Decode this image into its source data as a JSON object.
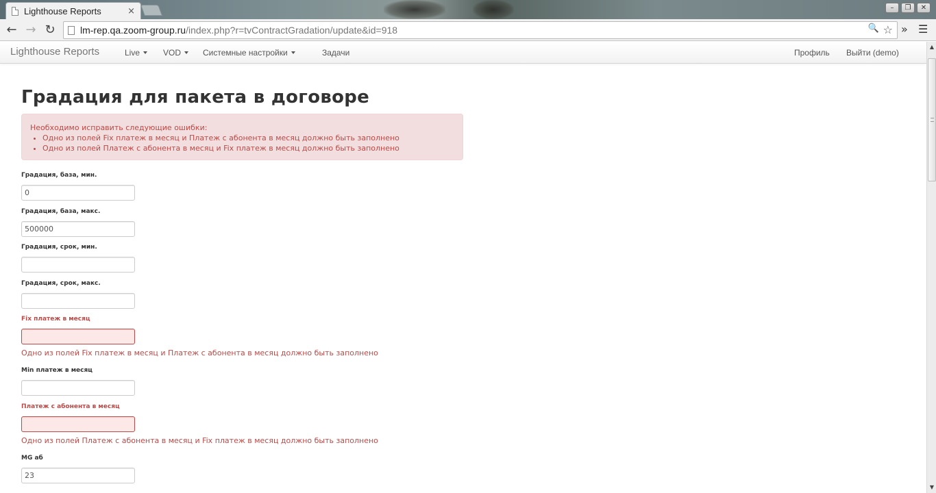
{
  "browser": {
    "tab_title": "Lighthouse Reports",
    "tab_close": "×",
    "window_buttons": [
      "–",
      "❐",
      "✕"
    ],
    "url_host": "lm-rep.qa.zoom-group.ru",
    "url_path": "/index.php?r=tvContractGradation/update&id=918",
    "back_icon": "←",
    "forward_icon": "→",
    "reload_icon": "↻",
    "zoom_icon": "🔍",
    "star_icon": "☆",
    "more_icon": "»",
    "menu_icon": "☰"
  },
  "navbar": {
    "brand": "Lighthouse Reports",
    "items": [
      {
        "label": "Live",
        "dropdown": true
      },
      {
        "label": "VOD",
        "dropdown": true
      },
      {
        "label": "Системные настройки",
        "dropdown": true
      },
      {
        "label": "Задачи",
        "dropdown": false
      }
    ],
    "right_items": [
      {
        "label": "Профиль"
      },
      {
        "label": "Выйти (demo)"
      }
    ]
  },
  "page": {
    "title": "Градация для пакета в договоре",
    "error_summary": {
      "heading": "Необходимо исправить следующие ошибки:",
      "items": [
        "Одно из полей Fix платеж в месяц и Платеж с абонента в месяц должно быть заполнено",
        "Одно из полей Платеж с абонента в месяц и Fix платеж в месяц должно быть заполнено"
      ]
    },
    "fields": [
      {
        "label": "Градация, база, мин.",
        "value": "0",
        "error": ""
      },
      {
        "label": "Градация, база, макс.",
        "value": "500000",
        "error": ""
      },
      {
        "label": "Градация, срок, мин.",
        "value": "",
        "error": ""
      },
      {
        "label": "Градация, срок, макс.",
        "value": "",
        "error": ""
      },
      {
        "label": "Fix платеж в месяц",
        "value": "",
        "error": "Одно из полей Fix платеж в месяц и Платеж с абонента в месяц должно быть заполнено"
      },
      {
        "label": "Min платеж в месяц",
        "value": "",
        "error": ""
      },
      {
        "label": "Платеж с абонента в месяц",
        "value": "",
        "error": "Одно из полей Платеж с абонента в месяц и Fix платеж в месяц должно быть заполнено"
      },
      {
        "label": "MG аб",
        "value": "23",
        "error": ""
      }
    ]
  },
  "colors": {
    "error_text": "#b94a48",
    "error_bg": "#f2dede",
    "error_input_bg": "#fde8e8"
  }
}
